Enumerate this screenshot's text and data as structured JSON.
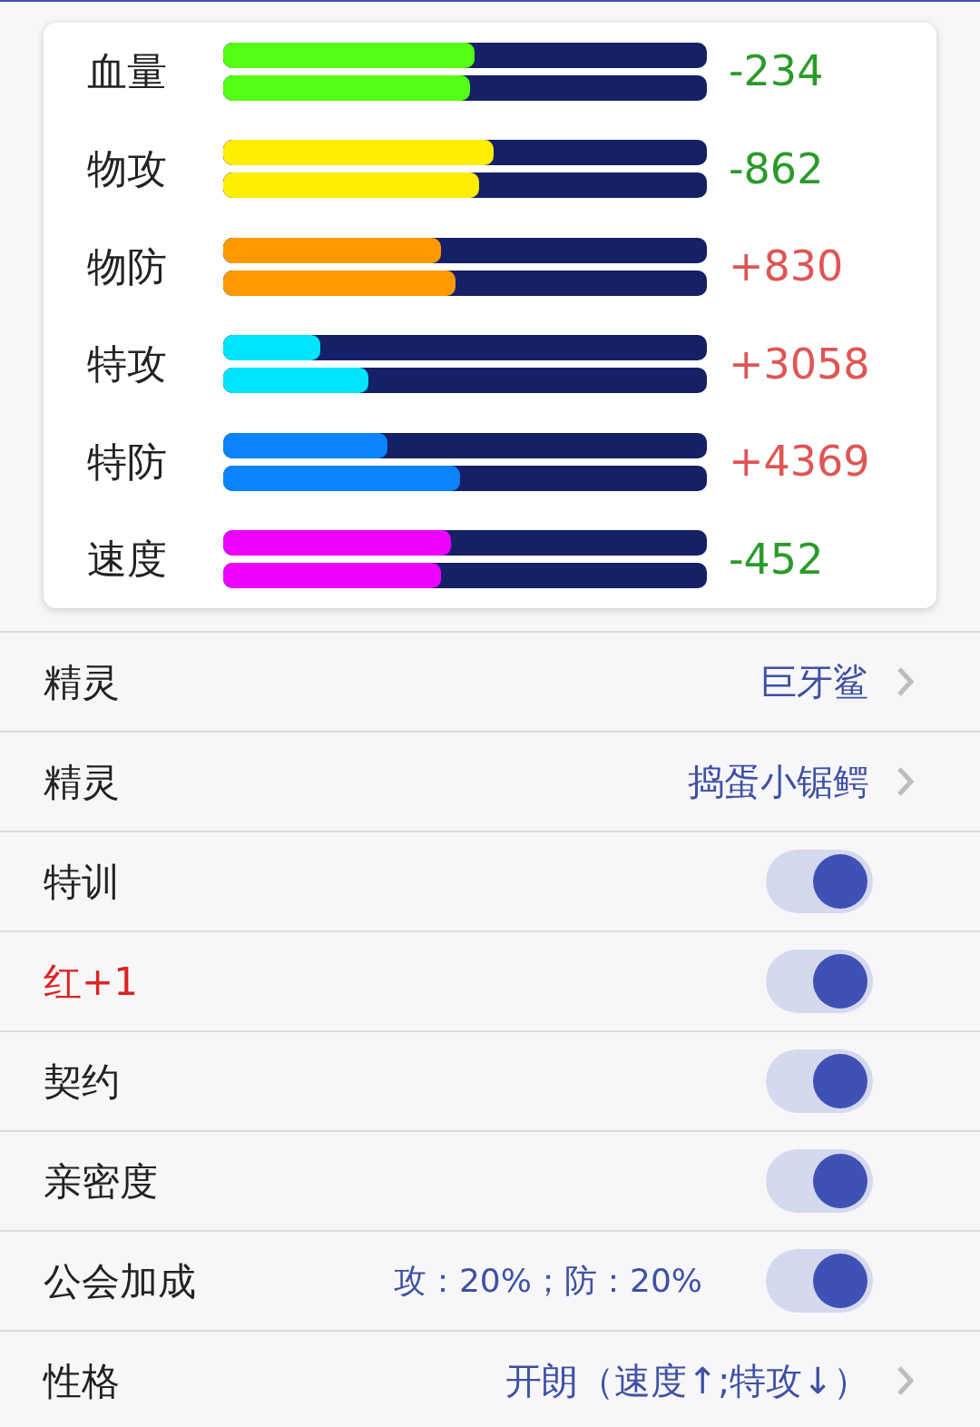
{
  "stats": [
    {
      "label": "血量",
      "color": "#55ff11",
      "bars": [
        {
          "level": 0.52
        },
        {
          "level": 0.51
        }
      ],
      "change": {
        "kind": "decrease",
        "text": "-234"
      }
    },
    {
      "label": "物攻",
      "color": "#ffee00",
      "bars": [
        {
          "level": 0.56
        },
        {
          "level": 0.53
        }
      ],
      "change": {
        "kind": "decrease",
        "text": "-862"
      }
    },
    {
      "label": "物防",
      "color": "#ff9900",
      "bars": [
        {
          "level": 0.45
        },
        {
          "level": 0.48
        }
      ],
      "change": {
        "kind": "increase",
        "text": "+830"
      }
    },
    {
      "label": "特攻",
      "color": "#00e5ff",
      "bars": [
        {
          "level": 0.2
        },
        {
          "level": 0.3
        }
      ],
      "change": {
        "kind": "increase",
        "text": "+3058"
      }
    },
    {
      "label": "特防",
      "color": "#0a84ff",
      "bars": [
        {
          "level": 0.34
        },
        {
          "level": 0.49
        }
      ],
      "change": {
        "kind": "increase",
        "text": "+4369"
      }
    },
    {
      "label": "速度",
      "color": "#ee00ff",
      "bars": [
        {
          "level": 0.47
        },
        {
          "level": 0.45
        }
      ],
      "change": {
        "kind": "decrease",
        "text": "-452"
      }
    }
  ],
  "settings": [
    {
      "kind": "link",
      "label": "精灵",
      "value": "巨牙鲨"
    },
    {
      "kind": "link",
      "label": "精灵",
      "value": "捣蛋小锯鳄"
    },
    {
      "kind": "toggle",
      "label": "特训",
      "on": true
    },
    {
      "kind": "toggle",
      "label": "红+1",
      "color": "#dd2222",
      "on": true
    },
    {
      "kind": "toggle",
      "label": "契约",
      "on": true
    },
    {
      "kind": "toggle",
      "label": "亲密度",
      "on": true
    },
    {
      "kind": "toggle",
      "label": "公会加成",
      "value": "攻：20%；防：20%",
      "on": true
    },
    {
      "kind": "link",
      "label": "性格",
      "value": "开朗（速度↑;特攻↓）"
    }
  ]
}
